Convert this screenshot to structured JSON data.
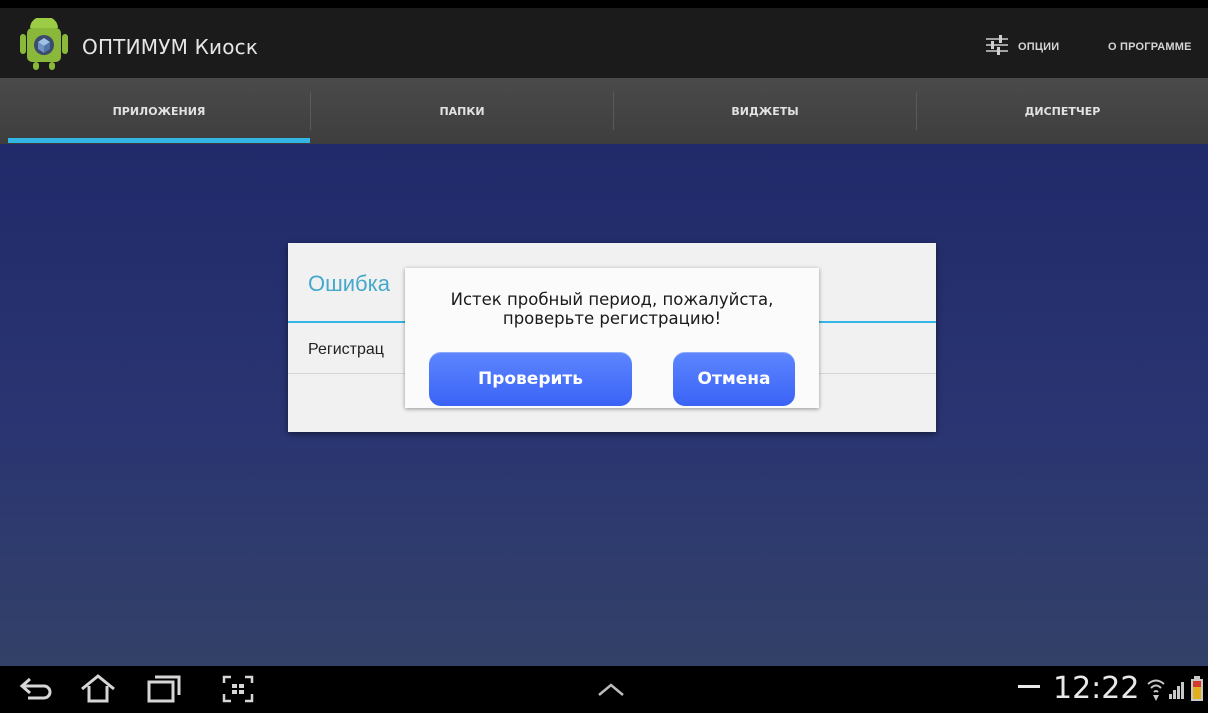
{
  "app": {
    "title": "ОПТИМУМ Киоск",
    "actions": [
      "ОПЦИИ",
      "О ПРОГРАММЕ"
    ],
    "icons": [
      "android-app-icon",
      "sliders-icon"
    ]
  },
  "tabs": {
    "items": [
      {
        "label": "ПРИЛОЖЕНИЯ",
        "selected": true
      },
      {
        "label": "ПАПКИ",
        "selected": false
      },
      {
        "label": "ВИДЖЕТЫ",
        "selected": false
      },
      {
        "label": "ДИСПЕТЧЕР",
        "selected": false
      }
    ],
    "indicator_color": "#33b5e5"
  },
  "error_dialog": {
    "title": "Ошибка",
    "body": "Регистрац"
  },
  "popup": {
    "message_line1": "Истек пробный период, пожалуйста,",
    "message_line2": "проверьте регистрацию!",
    "confirm_label": "Проверить",
    "cancel_label": "Отмена",
    "button_color": "#4a72fb"
  },
  "navbar": {
    "icons": [
      "back-icon",
      "home-icon",
      "recent-apps-icon",
      "screenshot-icon",
      "up-arrow-icon"
    ],
    "minus_icon": "minus-icon",
    "time": "12:22",
    "status_icons": [
      "wifi-icon",
      "signal-icon",
      "battery-icon"
    ]
  }
}
